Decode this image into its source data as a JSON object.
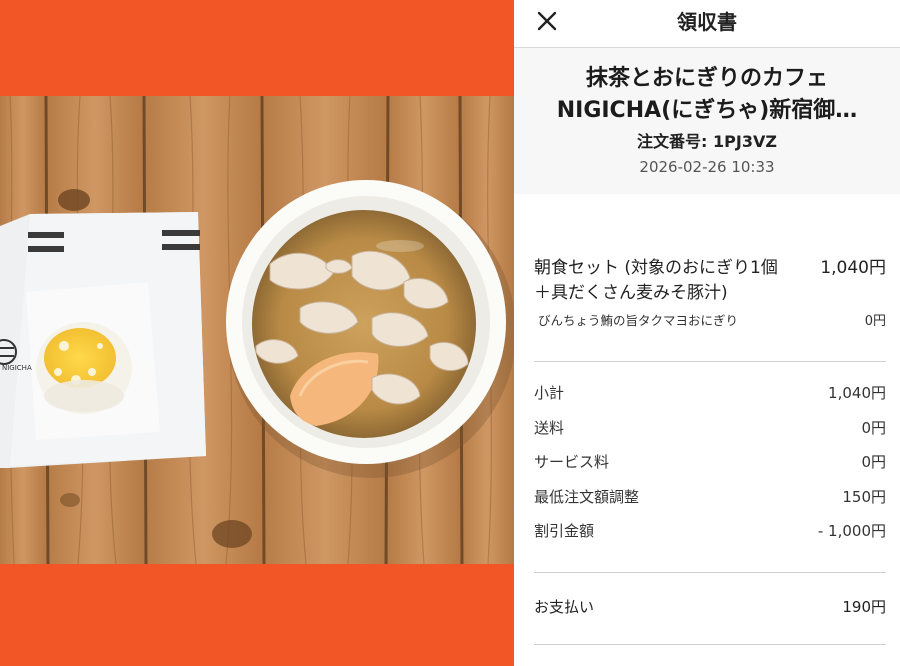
{
  "header_bar": {
    "title": "領収書",
    "close_icon": "close-icon"
  },
  "shop": {
    "name_line1": "抹茶とおにぎりのカフェ",
    "name_line2": "NIGICHA(にぎちゃ)新宿御…",
    "order_number": "注文番号: 1PJ3VZ",
    "order_date": "2026-02-26 10:33"
  },
  "item": {
    "name": "朝食セット (対象のおにぎり1個＋具だくさん麦みそ豚汁)",
    "price": "1,040円",
    "option_name": "びんちょう鮪の旨タクマヨおにぎり",
    "option_price": "0円"
  },
  "summary": [
    {
      "label": "小計",
      "value": "1,040円"
    },
    {
      "label": "送料",
      "value": "0円"
    },
    {
      "label": "サービス料",
      "value": "0円"
    },
    {
      "label": "最低注文額調整",
      "value": "150円"
    },
    {
      "label": "割引金額",
      "value": "- 1,000円"
    }
  ],
  "total": {
    "label": "お支払い",
    "value": "190円"
  },
  "photo": {
    "bag_print": "NIGICHA"
  },
  "colors": {
    "accent": "#f25526",
    "wood": "#c48a55",
    "header_bg": "#f7f7f7"
  }
}
